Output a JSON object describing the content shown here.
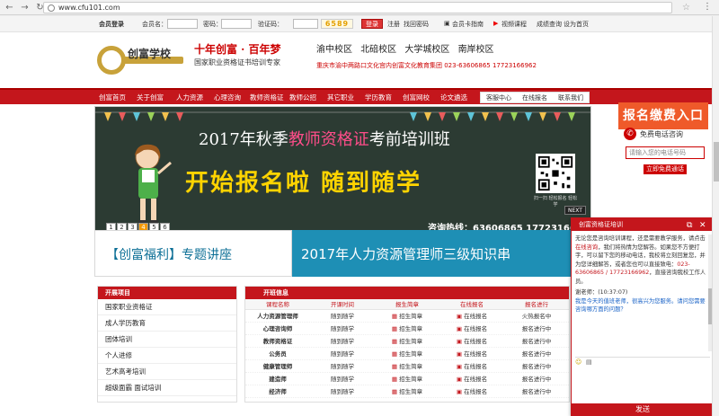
{
  "browser": {
    "url": "www.cfu101.com"
  },
  "loginbar": {
    "member_login": "会员登录",
    "member_name_label": "会员名：",
    "password_label": "密码：",
    "captcha_label": "验证码：",
    "captcha_value": "6589",
    "login_button": "登录",
    "register_link": "注册",
    "find_password_link": "找回密码",
    "member_card": "会员卡指南",
    "video_course": "视频课程",
    "results_query": "成绩查询",
    "set_homepage": "设为首页"
  },
  "header": {
    "logo_text": "创富学校",
    "slogan": "十年创富 · 百年梦",
    "slogan_sub": "国家职业资格证书培训专家",
    "campuses": [
      "渝中校区",
      "北碚校区",
      "大学城校区",
      "南岸校区"
    ],
    "address": "重庆市渝中两路口文化宫内创富文化教育集团 023-63606865 17723166962"
  },
  "nav": {
    "items": [
      "创富首页",
      "关于创富",
      "人力资源",
      "心理咨询",
      "教师资格证",
      "教师公招",
      "其它职业",
      "学历教育",
      "创富网校",
      "论文遴选"
    ],
    "right_items": [
      "客服中心",
      "在线报名",
      "联系我们"
    ]
  },
  "banner": {
    "title_prefix": "2017年秋季",
    "title_highlight": "教师资格证",
    "title_suffix": "考前培训班",
    "slogan": "开始报名啦    随到随学",
    "qr_label": "扫一扫 轻松报名 轻松学",
    "hotline": "咨询热线：63606865  17723166",
    "pages": [
      "1",
      "2",
      "3",
      "4",
      "5",
      "6"
    ],
    "active_page": "4",
    "next_label": "NEXT"
  },
  "side": {
    "register": "报名缴费入口",
    "free_call": "免费电话咨询",
    "phone_placeholder": "请输入您的电话号码",
    "call_button": "立即免费通话"
  },
  "banner2": {
    "welfare": "【创富福利】专题讲座",
    "course": "2017年人力资源管理师三级知识串"
  },
  "leftlist": {
    "head": "开展项目",
    "items": [
      "国家职业资格证",
      "成人学历教育",
      "团体培训",
      "个人进修",
      "艺术高考培训",
      "超级面霸 面试培训"
    ]
  },
  "table": {
    "head": "开班信息",
    "columns": [
      "课程名称",
      "开课时间",
      "报生简章",
      "在线报名",
      "报名进行"
    ],
    "rows": [
      {
        "name": "人力资源管理师",
        "time": "随到随学",
        "brochure": "招生简章",
        "signup": "在线报名",
        "status": "火热报名中"
      },
      {
        "name": "心理咨询师",
        "time": "随到随学",
        "brochure": "招生简章",
        "signup": "在线报名",
        "status": "报名进行中"
      },
      {
        "name": "教师资格证",
        "time": "随到随学",
        "brochure": "招生简章",
        "signup": "在线报名",
        "status": "报名进行中"
      },
      {
        "name": "公务员",
        "time": "随到随学",
        "brochure": "招生简章",
        "signup": "在线报名",
        "status": "报名进行中"
      },
      {
        "name": "健康管理师",
        "time": "随到随学",
        "brochure": "招生简章",
        "signup": "在线报名",
        "status": "报名进行中"
      },
      {
        "name": "建造师",
        "time": "随到随学",
        "brochure": "招生简章",
        "signup": "在线报名",
        "status": "报名进行中"
      },
      {
        "name": "经济师",
        "time": "随到随学",
        "brochure": "招生简章",
        "signup": "在线报名",
        "status": "报名进行中"
      }
    ]
  },
  "chat": {
    "title": "创富资格证培训",
    "greeting_1": "无论您是咨询培训课程，还是需要教学服务，请点击",
    "online_consult": "在线咨询",
    "greeting_2": "，我们将热情为您解答。如果您不方便打字，可以留下您的移动电话，我校将立刻回复您，并为您详细解答，或者您也可以直接致电：",
    "phone": "023-63606865 / 17723166962",
    "greeting_3": "，直接咨询我校工作人员。",
    "agent_label": "谢老师：(10:37:07)",
    "agent_msg": "我是今天的值班老师，很高兴为您服务。请问您需要咨询哪方面的问题？",
    "send": "发送"
  }
}
